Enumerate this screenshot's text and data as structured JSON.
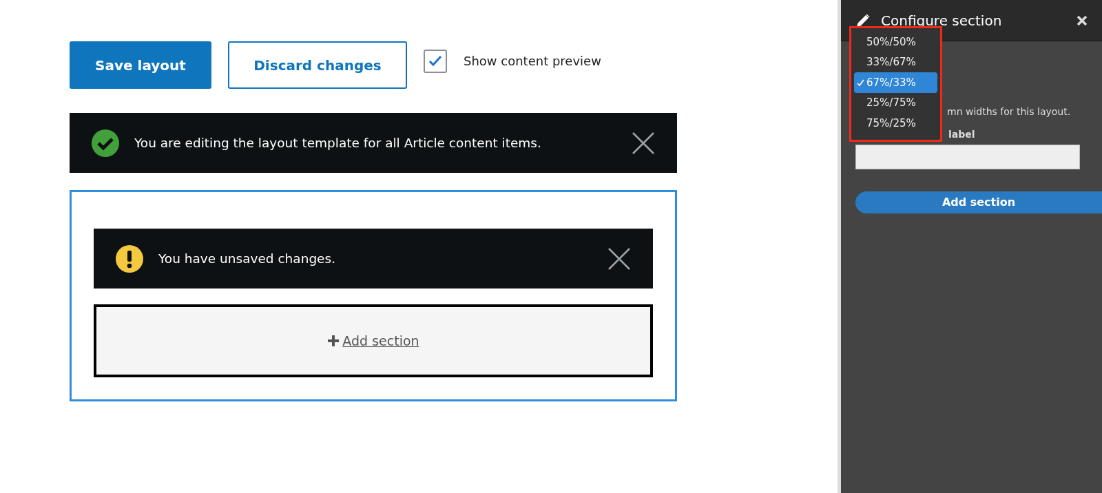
{
  "toolbar": {
    "save_button": "Save layout",
    "discard_button": "Discard changes",
    "preview_checkbox": {
      "label": "Show content preview",
      "checked": true
    }
  },
  "messages": [
    {
      "kind": "status",
      "text": "You are editing the layout template for all Article content items."
    }
  ],
  "section_area": {
    "messages": [
      {
        "kind": "warning",
        "text": "You have unsaved changes."
      }
    ],
    "add_section_link": "Add section"
  },
  "off_canvas": {
    "title": "Configure section",
    "description": "mn widths for this layout.",
    "label": "label",
    "submit_button": "Add section",
    "dropdown": {
      "highlighted": true,
      "options": [
        {
          "label": "50%/50%",
          "selected": false
        },
        {
          "label": "33%/67%",
          "selected": false
        },
        {
          "label": "67%/33%",
          "selected": true
        },
        {
          "label": "25%/75%",
          "selected": false
        },
        {
          "label": "75%/25%",
          "selected": false
        }
      ]
    }
  }
}
